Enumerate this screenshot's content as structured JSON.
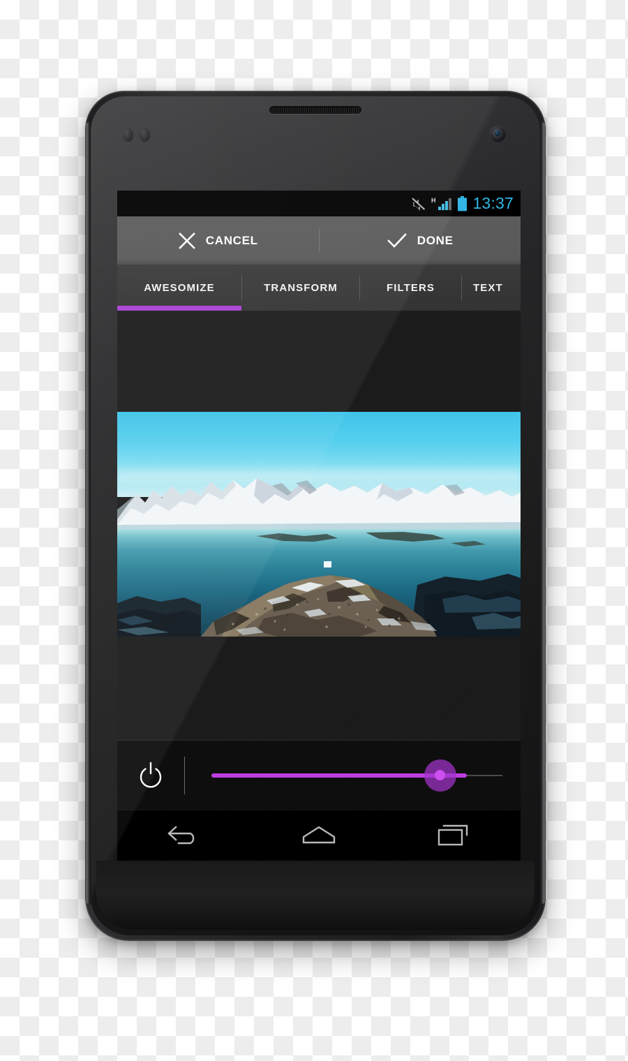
{
  "device": {
    "name": "android-smartphone",
    "earpiece": "speaker-grille",
    "front_camera": "front-camera"
  },
  "statusbar": {
    "time": "13:37",
    "time_color": "#33b5e5",
    "icons": [
      {
        "name": "silent-mode-icon",
        "label": "Silent"
      },
      {
        "name": "signal-hspa-icon",
        "label": "H"
      },
      {
        "name": "battery-icon",
        "label": "Battery"
      }
    ]
  },
  "actionbar": {
    "background": "#595959",
    "cancel": {
      "label": "CANCEL",
      "icon": "close-icon"
    },
    "done": {
      "label": "DONE",
      "icon": "check-icon"
    }
  },
  "tabs": {
    "accent": "#a73fd3",
    "active_index": 0,
    "items": [
      {
        "label": "AWESOMIZE"
      },
      {
        "label": "TRANSFORM"
      },
      {
        "label": "FILTERS"
      },
      {
        "label": "TEXT"
      }
    ]
  },
  "editor": {
    "photo": {
      "name": "arctic-landscape-photo",
      "description": "Snow-covered mountains above a turquoise fjord with a rocky snow-patched foreground",
      "sky_color": "#55cdec",
      "water_color": "#2c8298",
      "rock_color": "#7a6a52"
    }
  },
  "slider": {
    "power_icon": "power-icon",
    "value_percent": 76,
    "track_color": "#bb3fe0",
    "thumb_color": "#cc4ff0",
    "track_bg_color": "#4a4a4a"
  },
  "navbar": {
    "buttons": [
      {
        "name": "back-button",
        "icon": "back-arrow-icon"
      },
      {
        "name": "home-button",
        "icon": "home-icon"
      },
      {
        "name": "recents-button",
        "icon": "recents-icon"
      }
    ]
  }
}
